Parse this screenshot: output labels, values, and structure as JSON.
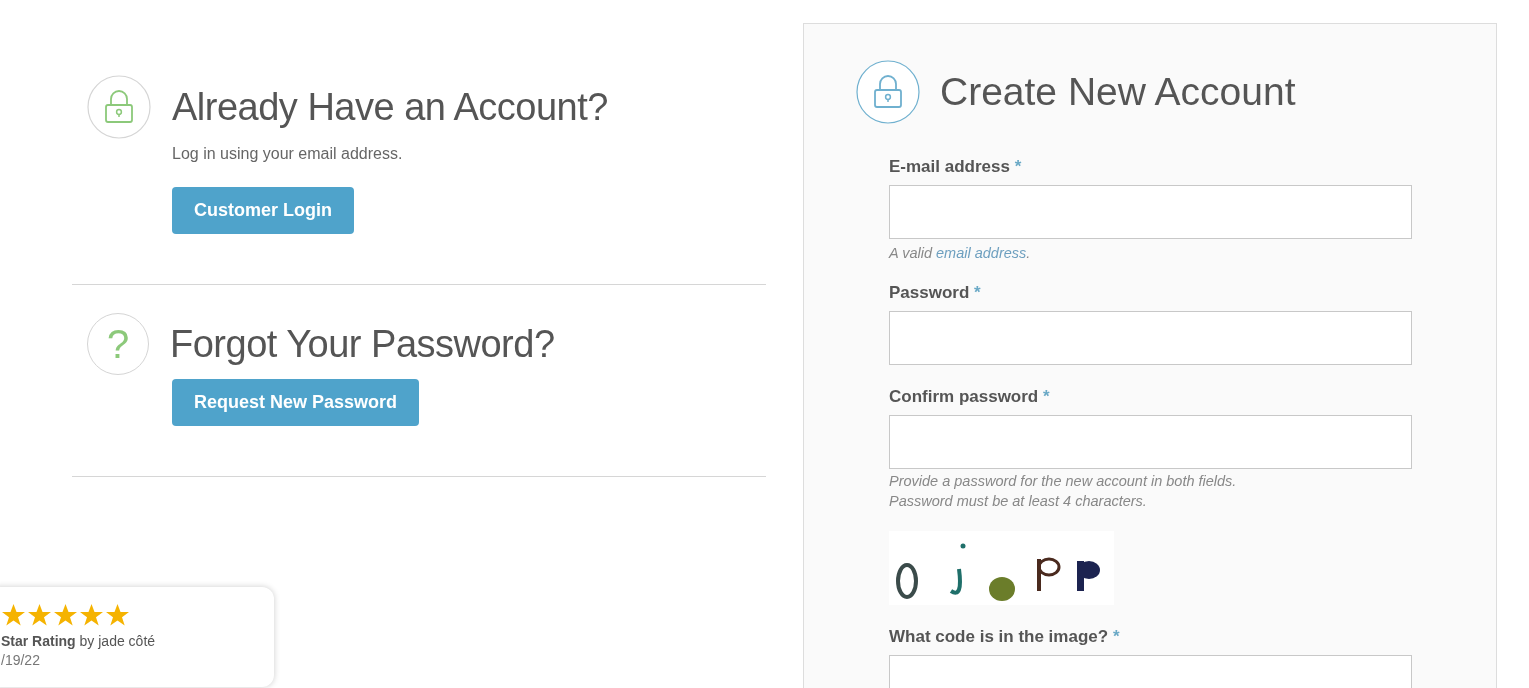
{
  "sections": [
    {
      "kind": "lock",
      "title": "Already Have an Account?",
      "subtitle": "Log in using your email address.",
      "button": "Customer Login"
    },
    {
      "kind": "question",
      "title": "Forgot Your Password?",
      "button": "Request New Password"
    }
  ],
  "question_glyph": "?",
  "register": {
    "title": "Create New Account",
    "fields": [
      {
        "kind": "input",
        "label": "E-mail address",
        "marker": "*",
        "hint_prefix": "A valid ",
        "hint_link": "email address",
        "hint_suffix": "."
      },
      {
        "kind": "input",
        "label": "Password",
        "marker": "*"
      },
      {
        "kind": "input",
        "label": "Confirm password",
        "marker": "*",
        "notes": [
          "Provide a password for the new account in both fields.",
          "Password must be at least 4 characters."
        ]
      },
      {
        "kind": "captcha"
      },
      {
        "kind": "input",
        "label": "What code is in the image?",
        "marker": "*"
      }
    ]
  },
  "review": {
    "stars": 5,
    "title": "Star Rating",
    "byline": " by jade côté",
    "date": "/19/22"
  }
}
